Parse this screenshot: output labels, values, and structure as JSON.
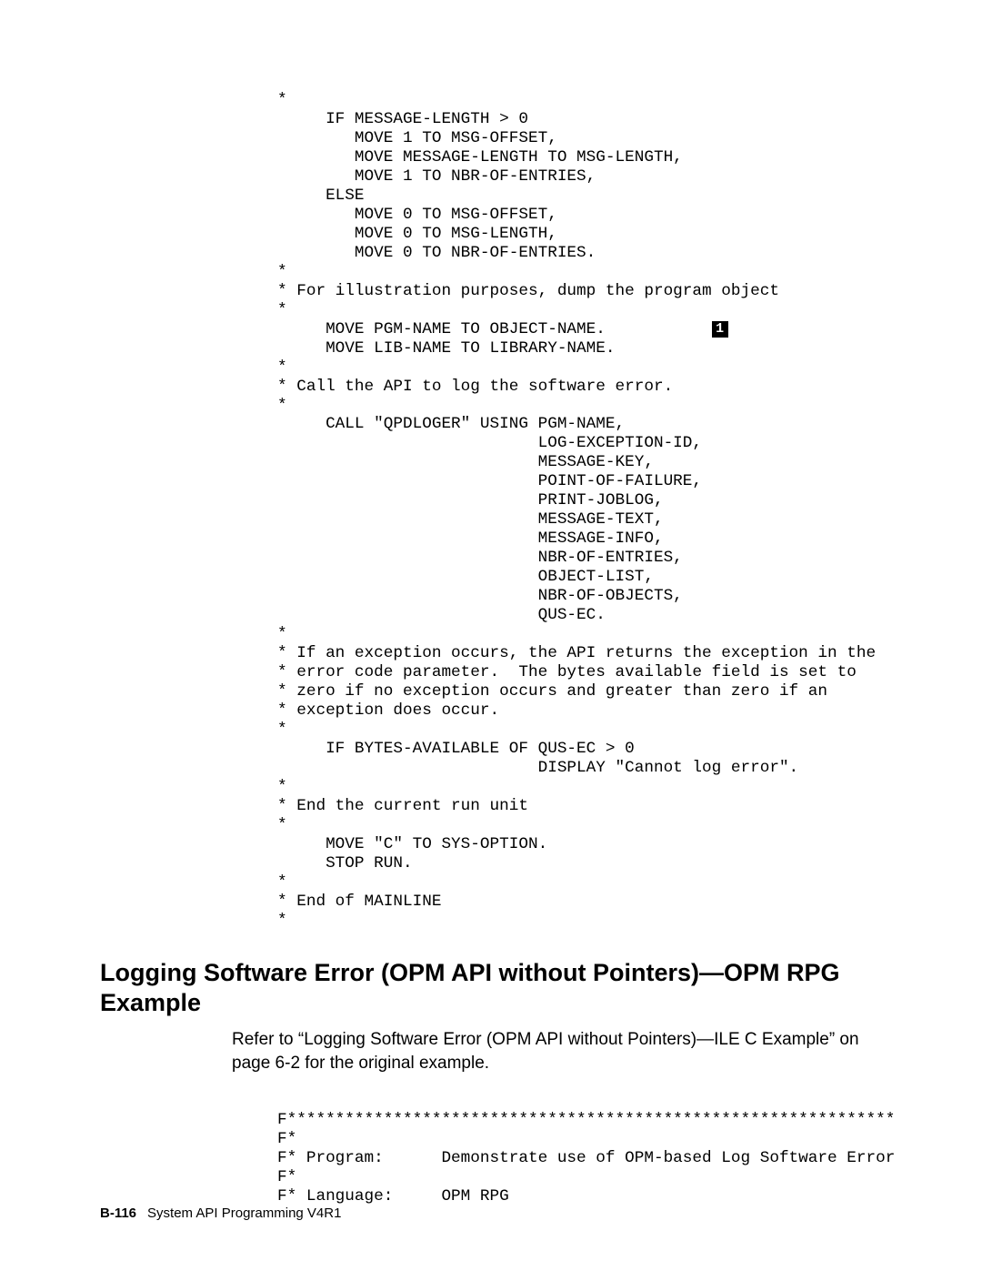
{
  "code1_a": "*\n     IF MESSAGE-LENGTH > 0\n        MOVE 1 TO MSG-OFFSET,\n        MOVE MESSAGE-LENGTH TO MSG-LENGTH,\n        MOVE 1 TO NBR-OF-ENTRIES,\n     ELSE\n        MOVE 0 TO MSG-OFFSET,\n        MOVE 0 TO MSG-LENGTH,\n        MOVE 0 TO NBR-OF-ENTRIES.\n*\n* For illustration purposes, dump the program object\n*",
  "code1_callline": "     MOVE PGM-NAME TO OBJECT-NAME.           ",
  "callout_label": "1",
  "code1_b": "     MOVE LIB-NAME TO LIBRARY-NAME.\n*\n* Call the API to log the software error.\n*\n     CALL \"QPDLOGER\" USING PGM-NAME,\n                           LOG-EXCEPTION-ID,\n                           MESSAGE-KEY,\n                           POINT-OF-FAILURE,\n                           PRINT-JOBLOG,\n                           MESSAGE-TEXT,\n                           MESSAGE-INFO,\n                           NBR-OF-ENTRIES,\n                           OBJECT-LIST,\n                           NBR-OF-OBJECTS,\n                           QUS-EC.\n*\n* If an exception occurs, the API returns the exception in the\n* error code parameter.  The bytes available field is set to\n* zero if no exception occurs and greater than zero if an\n* exception does occur.\n*\n     IF BYTES-AVAILABLE OF QUS-EC > 0\n                           DISPLAY \"Cannot log error\".\n*\n* End the current run unit\n*\n     MOVE \"C\" TO SYS-OPTION.\n     STOP RUN.\n*\n* End of MAINLINE\n*",
  "section_heading": "Logging Software Error (OPM API without Pointers)—OPM RPG Example",
  "body_text": "Refer to “Logging Software Error (OPM API without Pointers)—ILE C Example” on page 6-2 for the original example.",
  "code2": "F***************************************************************\nF*\nF* Program:      Demonstrate use of OPM-based Log Software Error\nF*\nF* Language:     OPM RPG",
  "footer": {
    "page": "B-116",
    "title": "System API Programming V4R1"
  }
}
